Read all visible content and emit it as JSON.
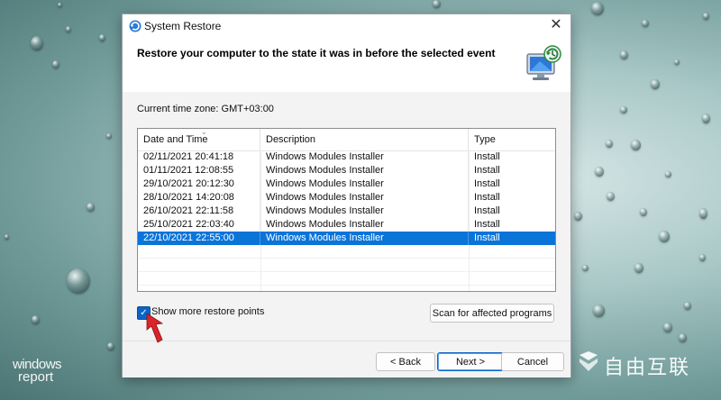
{
  "window": {
    "title": "System Restore",
    "close_glyph": "✕",
    "heading": "Restore your computer to the state it was in before the selected event",
    "timezone": "Current time zone: GMT+03:00"
  },
  "table": {
    "columns": [
      "Date and Time",
      "Description",
      "Type"
    ],
    "rows": [
      {
        "date": "02/11/2021 20:41:18",
        "description": "Windows Modules Installer",
        "type": "Install"
      },
      {
        "date": "01/11/2021 12:08:55",
        "description": "Windows Modules Installer",
        "type": "Install"
      },
      {
        "date": "29/10/2021 20:12:30",
        "description": "Windows Modules Installer",
        "type": "Install"
      },
      {
        "date": "28/10/2021 14:20:08",
        "description": "Windows Modules Installer",
        "type": "Install"
      },
      {
        "date": "26/10/2021 22:11:58",
        "description": "Windows Modules Installer",
        "type": "Install"
      },
      {
        "date": "25/10/2021 22:03:40",
        "description": "Windows Modules Installer",
        "type": "Install"
      },
      {
        "date": "22/10/2021 22:55:00",
        "description": "Windows Modules Installer",
        "type": "Install"
      }
    ],
    "selected_index": 6
  },
  "options": {
    "show_more_label": "Show more restore points",
    "show_more_checked": true,
    "scan_label": "Scan for affected programs"
  },
  "footer": {
    "back_label": "< Back",
    "next_label": "Next >",
    "cancel_label": "Cancel"
  },
  "watermarks": {
    "windows_report_line1": "windows",
    "windows_report_line2": "report",
    "cn_text": "自由互联"
  },
  "colors": {
    "selection": "#0a74d8",
    "accent": "#0a64c8",
    "arrow": "#d9242a"
  },
  "icons": [
    "system-restore-icon",
    "close-icon",
    "restore-computer-icon",
    "checkmark-icon",
    "red-arrow-icon"
  ]
}
